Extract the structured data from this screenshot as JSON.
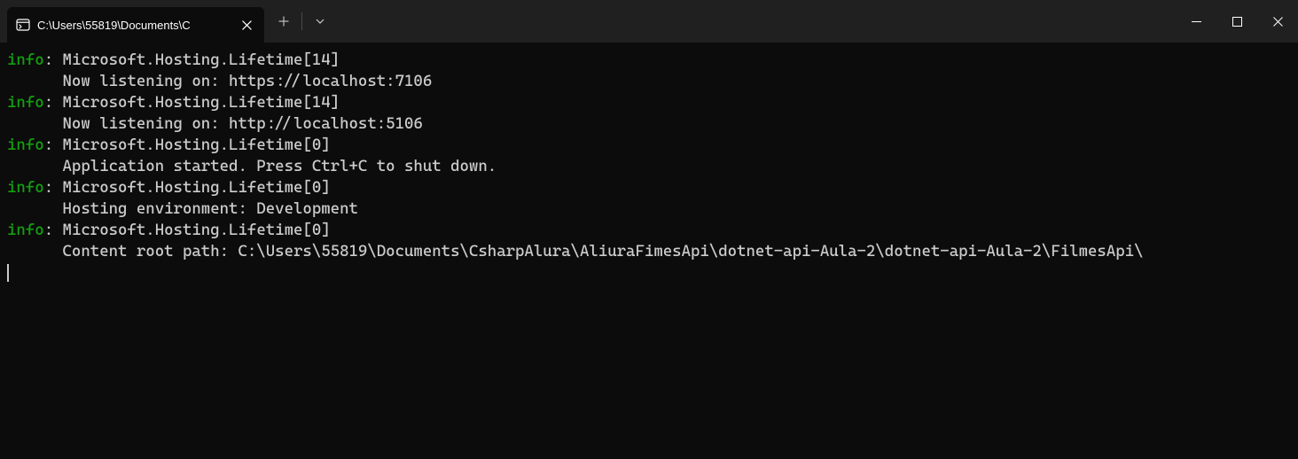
{
  "window": {
    "tab_title": "C:\\Users\\55819\\Documents\\C"
  },
  "log": {
    "level_label": "info",
    "entries": [
      {
        "category": "Microsoft.Hosting.Lifetime[14]",
        "message": "Now listening on: https://localhost:7106"
      },
      {
        "category": "Microsoft.Hosting.Lifetime[14]",
        "message": "Now listening on: http://localhost:5106"
      },
      {
        "category": "Microsoft.Hosting.Lifetime[0]",
        "message": "Application started. Press Ctrl+C to shut down."
      },
      {
        "category": "Microsoft.Hosting.Lifetime[0]",
        "message": "Hosting environment: Development"
      },
      {
        "category": "Microsoft.Hosting.Lifetime[0]",
        "message": "Content root path: C:\\Users\\55819\\Documents\\CsharpAlura\\AliuraFimesApi\\dotnet-api-Aula-2\\dotnet-api-Aula-2\\FilmesApi\\"
      }
    ]
  }
}
